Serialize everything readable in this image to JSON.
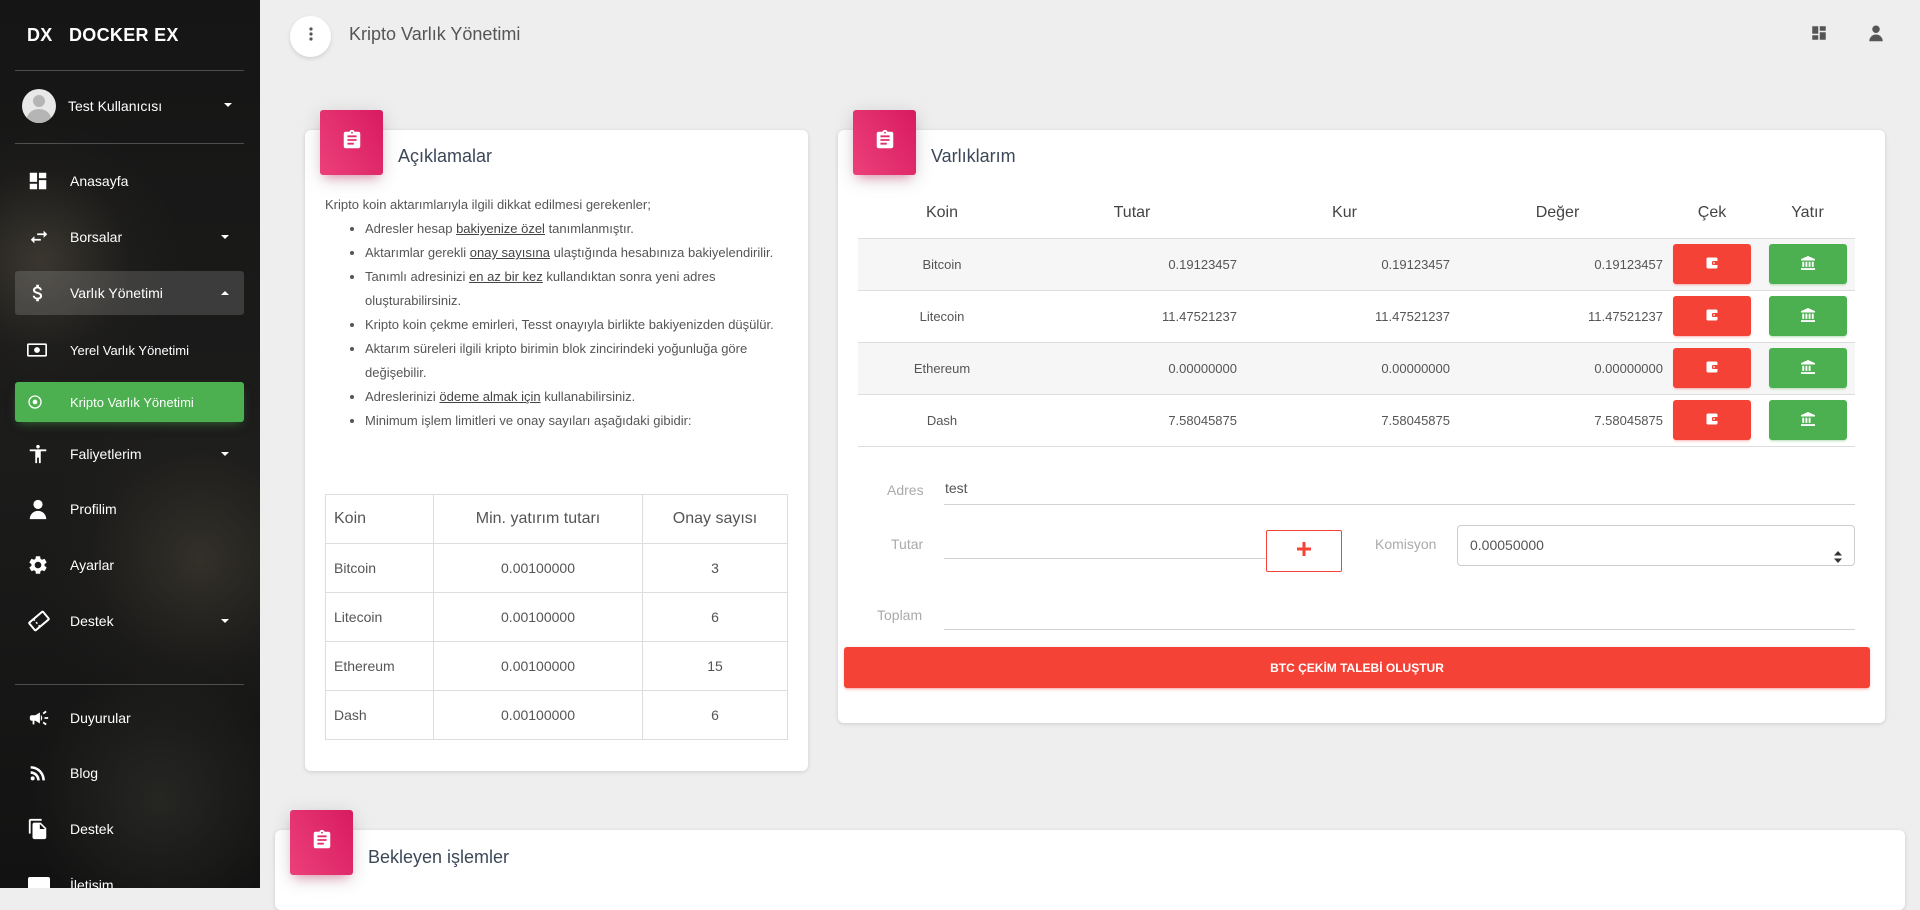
{
  "brand": {
    "mini": "DX",
    "name": "DOCKER EX"
  },
  "user": {
    "name": "Test Kullanıcısı"
  },
  "sidebar": {
    "items": [
      {
        "label": "Anasayfa",
        "icon": "dashboard-icon"
      },
      {
        "label": "Borsalar",
        "icon": "swap-arrows-icon"
      },
      {
        "label": "Varlık Yönetimi",
        "icon": "dollar-icon"
      },
      {
        "label": "Yerel Varlık Yönetimi",
        "icon": "money-icon"
      },
      {
        "label": "Kripto Varlık Yönetimi",
        "icon": "crypto-icon"
      },
      {
        "label": "Faliyetlerim",
        "icon": "accessibility-icon"
      },
      {
        "label": "Profilim",
        "icon": "person-icon"
      },
      {
        "label": "Ayarlar",
        "icon": "gear-icon"
      },
      {
        "label": "Destek",
        "icon": "ticket-icon"
      },
      {
        "label": "Duyurular",
        "icon": "megaphone-icon"
      },
      {
        "label": "Blog",
        "icon": "rss-icon"
      },
      {
        "label": "Destek",
        "icon": "file-copy-icon"
      },
      {
        "label": "İletişim",
        "icon": "contact-icon"
      }
    ]
  },
  "topbar": {
    "title": "Kripto Varlık Yönetimi"
  },
  "explanations": {
    "title": "Açıklamalar",
    "intro": "Kripto koin aktarımlarıyla ilgili dikkat edilmesi gerekenler;",
    "bullets": [
      {
        "pre": "Adresler hesap ",
        "u": "bakiyenize özel",
        "post": " tanımlanmıştır."
      },
      {
        "pre": "Aktarımlar gerekli ",
        "u": "onay sayısına",
        "post": " ulaştığında hesabınıza bakiyelendirilir."
      },
      {
        "pre": "Tanımlı adresinizi ",
        "u": "en az bir kez",
        "post": " kullandıktan sonra yeni adres oluşturabilirsiniz."
      },
      {
        "pre": "Kripto koin çekme emirleri, Tesst onayıyla birlikte bakiyenizden düşülür.",
        "u": "",
        "post": ""
      },
      {
        "pre": "Aktarım süreleri ilgili kripto birimin blok zincirindeki yoğunluğa göre değişebilir.",
        "u": "",
        "post": ""
      },
      {
        "pre": "Adreslerinizi ",
        "u": "ödeme almak için",
        "post": " kullanabilirsiniz."
      },
      {
        "pre": "Minimum işlem limitleri ve onay sayıları aşağıdaki gibidir:",
        "u": "",
        "post": ""
      }
    ],
    "limits": {
      "headers": [
        "Koin",
        "Min. yatırım tutarı",
        "Onay sayısı"
      ],
      "rows": [
        [
          "Bitcoin",
          "0.00100000",
          "3"
        ],
        [
          "Litecoin",
          "0.00100000",
          "6"
        ],
        [
          "Ethereum",
          "0.00100000",
          "15"
        ],
        [
          "Dash",
          "0.00100000",
          "6"
        ]
      ]
    }
  },
  "assets": {
    "title": "Varlıklarım",
    "headers": [
      "Koin",
      "Tutar",
      "Kur",
      "Değer",
      "Çek",
      "Yatır"
    ],
    "rows": [
      [
        "Bitcoin",
        "0.19123457",
        "0.19123457",
        "0.19123457"
      ],
      [
        "Litecoin",
        "11.47521237",
        "11.47521237",
        "11.47521237"
      ],
      [
        "Ethereum",
        "0.00000000",
        "0.00000000",
        "0.00000000"
      ],
      [
        "Dash",
        "7.58045875",
        "7.58045875",
        "7.58045875"
      ]
    ],
    "form": {
      "address_label": "Adres",
      "address_value": "test",
      "amount_label": "Tutar",
      "amount_value": "",
      "commission_label": "Komisyon",
      "commission_value": "0.00050000",
      "total_label": "Toplam",
      "total_value": "",
      "submit_label": "BTC ÇEKİM TALEBİ OLUŞTUR"
    }
  },
  "pending": {
    "title": "Bekleyen işlemler"
  },
  "colors": {
    "accent": "#4caf50",
    "danger": "#f44336",
    "badge": "#e91e63"
  }
}
